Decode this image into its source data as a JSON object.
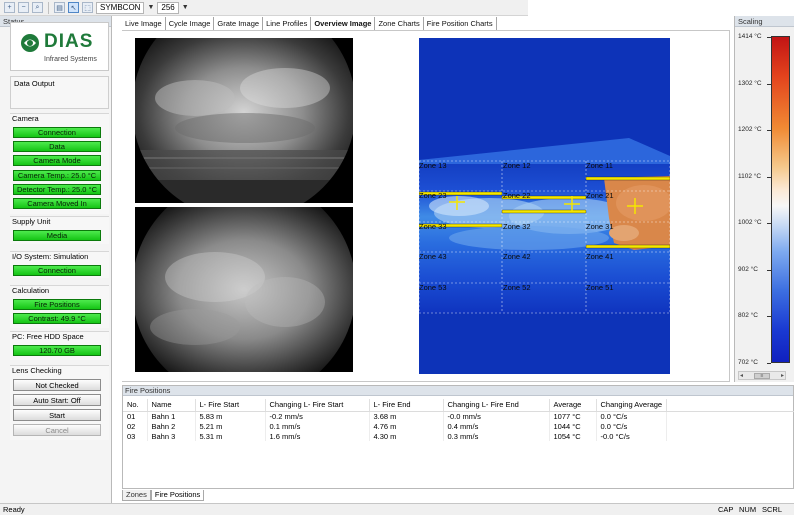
{
  "toolbar": {
    "source_select": "SYMBCON",
    "value_select": "256"
  },
  "status_panel": {
    "title": "Status",
    "logo_text": "DIAS",
    "logo_sub": "Infrared Systems",
    "data_output_label": "Data Output",
    "camera": {
      "label": "Camera",
      "buttons": [
        "Connection",
        "Data",
        "Camera Mode",
        "Camera Temp.: 25.0 °C",
        "Detector Temp.: 25.0 °C",
        "Camera Moved In"
      ]
    },
    "supply": {
      "label": "Supply Unit",
      "buttons": [
        "Media"
      ]
    },
    "io": {
      "label": "I/O System: Simulation",
      "buttons": [
        "Connection"
      ]
    },
    "calculation": {
      "label": "Calculation",
      "buttons": [
        "Fire Positions",
        "Contrast: 49.9 °C"
      ]
    },
    "hdd": {
      "label": "PC: Free HDD Space",
      "buttons": [
        "120.70 GB"
      ]
    },
    "lens": {
      "label": "Lens Checking",
      "buttons": [
        "Not Checked",
        "Auto Start: Off",
        "Start",
        "Cancel"
      ]
    }
  },
  "tabs": [
    "Live Image",
    "Cycle Image",
    "Grate Image",
    "Line Profiles",
    "Overview Image",
    "Zone Charts",
    "Fire Position Charts"
  ],
  "active_tab": "Overview Image",
  "zones": [
    [
      "Zone 13",
      "Zone 12",
      "Zone 11"
    ],
    [
      "Zone 23",
      "Zone 22",
      "Zone 21"
    ],
    [
      "Zone 33",
      "Zone 32",
      "Zone 31"
    ],
    [
      "Zone 43",
      "Zone 42",
      "Zone 41"
    ],
    [
      "Zone 53",
      "Zone 52",
      "Zone 51"
    ]
  ],
  "scaling": {
    "title": "Scaling",
    "ticks": [
      "1414 °C",
      "1302 °C",
      "1202 °C",
      "1102 °C",
      "1002 °C",
      "902 °C",
      "802 °C",
      "702 °C"
    ]
  },
  "fire_positions": {
    "title": "Fire Positions",
    "columns": [
      "No.",
      "Name",
      "L- Fire Start",
      "Changing L- Fire Start",
      "L- Fire End",
      "Changing L- Fire End",
      "Average",
      "Changing Average"
    ],
    "rows": [
      [
        "01",
        "Bahn 1",
        "5.83 m",
        "-0.2 mm/s",
        "3.68 m",
        "-0.0 mm/s",
        "1077 °C",
        "0.0 °C/s"
      ],
      [
        "02",
        "Bahn 2",
        "5.21 m",
        "0.1 mm/s",
        "4.76 m",
        "0.4 mm/s",
        "1044 °C",
        "0.0 °C/s"
      ],
      [
        "03",
        "Bahn 3",
        "5.31 m",
        "1.6 mm/s",
        "4.30 m",
        "0.3 mm/s",
        "1054 °C",
        "-0.0 °C/s"
      ]
    ]
  },
  "bottom_tabs": [
    "Zones",
    "Fire Positions"
  ],
  "statusbar": {
    "ready": "Ready",
    "indicators": [
      "CAP",
      "NUM",
      "SCRL"
    ]
  },
  "colors": {
    "status_green": "#15c515",
    "overview_blue": "#0d33b8",
    "hot_orange": "#d9874a",
    "marker_yellow": "#f5e600"
  }
}
